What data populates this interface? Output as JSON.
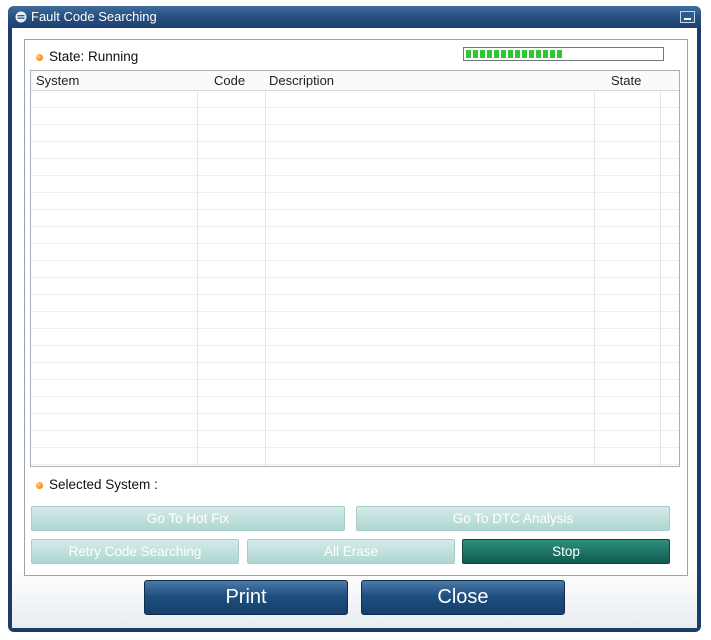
{
  "window": {
    "title": "Fault Code Searching"
  },
  "status": {
    "label": "State: Running",
    "progress_fraction": 0.5
  },
  "table": {
    "columns": [
      "System",
      "Code",
      "Description",
      "State"
    ],
    "rows": []
  },
  "selected_system": {
    "label": "Selected System :"
  },
  "buttons": {
    "hot_fix": "Go To Hot Fix",
    "dtc_analysis": "Go To DTC Analysis",
    "retry": "Retry Code Searching",
    "all_erase": "All Erase",
    "stop": "Stop",
    "print": "Print",
    "close": "Close"
  },
  "colors": {
    "title_bar": "#244c7c",
    "window_frame": "#1a3c66",
    "progress_fill": "#2ec82e",
    "status_dot": "#f08a10",
    "button_disabled": "#aed6d2",
    "button_active": "#0f5c4f",
    "footer_button": "#1d4f80"
  }
}
